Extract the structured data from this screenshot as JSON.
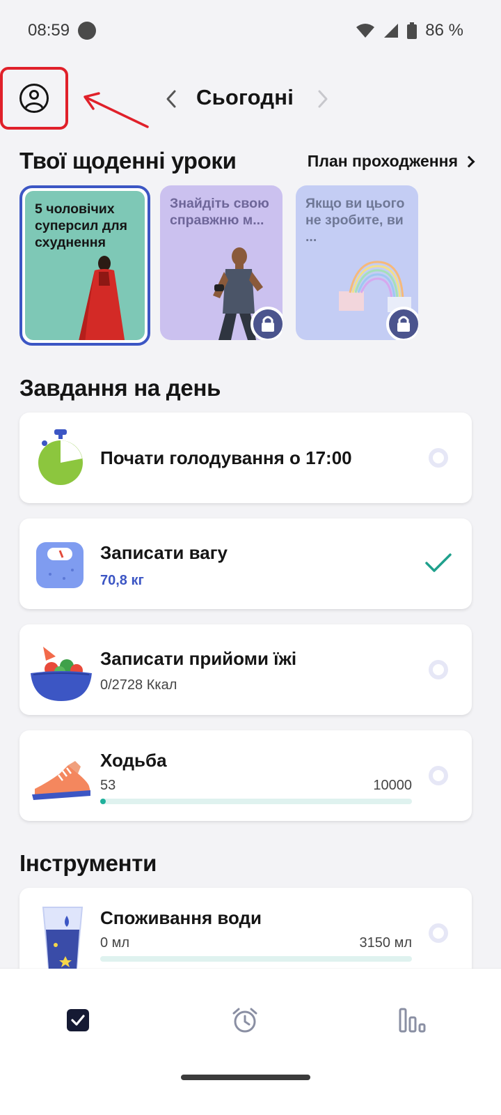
{
  "status_bar": {
    "time": "08:59",
    "battery": "86 %",
    "icons": [
      "notification-dot-icon",
      "wifi-icon",
      "signal-icon",
      "battery-icon"
    ]
  },
  "header": {
    "title": "Сьогодні",
    "profile_icon": "profile-icon",
    "prev_icon": "chevron-left-icon",
    "next_icon": "chevron-right-icon",
    "annotation_color": "#e0202a"
  },
  "lessons": {
    "title": "Твої щоденні уроки",
    "plan_link": "План проходження",
    "cards": [
      {
        "text": "5 чоловічих суперсил для схуднення",
        "locked": false,
        "color": "#7ec8b6"
      },
      {
        "text": "Знайдіть свою справжню м...",
        "locked": true,
        "color": "#cbc1ef"
      },
      {
        "text": "Якщо ви цього не зробите, ви ...",
        "locked": true,
        "color": "#c4cdf4"
      }
    ]
  },
  "tasks": {
    "title": "Завдання на день",
    "items": [
      {
        "title": "Почати голодування о 17:00",
        "icon": "timer-icon",
        "done": false
      },
      {
        "title": "Записати вагу",
        "subtitle": "70,8 кг",
        "icon": "scale-icon",
        "done": true
      },
      {
        "title": "Записати прийоми їжі",
        "subtitle": "0/2728 Ккал",
        "icon": "salad-bowl-icon",
        "done": false
      },
      {
        "title": "Ходьба",
        "current": "53",
        "goal": "10000",
        "progress": 0.0053,
        "icon": "sneaker-icon",
        "done": false
      }
    ]
  },
  "tools": {
    "title": "Інструменти",
    "items": [
      {
        "title": "Споживання води",
        "current": "0 мл",
        "goal": "3150 мл",
        "progress": 0,
        "icon": "water-glass-icon",
        "done": false
      }
    ]
  },
  "bottom_nav": {
    "items": [
      "tasks-icon",
      "alarm-clock-icon",
      "stats-icon"
    ],
    "active": 0
  },
  "colors": {
    "accent": "#3c56c4",
    "teal": "#1fb09b",
    "background": "#f3f3f6"
  }
}
